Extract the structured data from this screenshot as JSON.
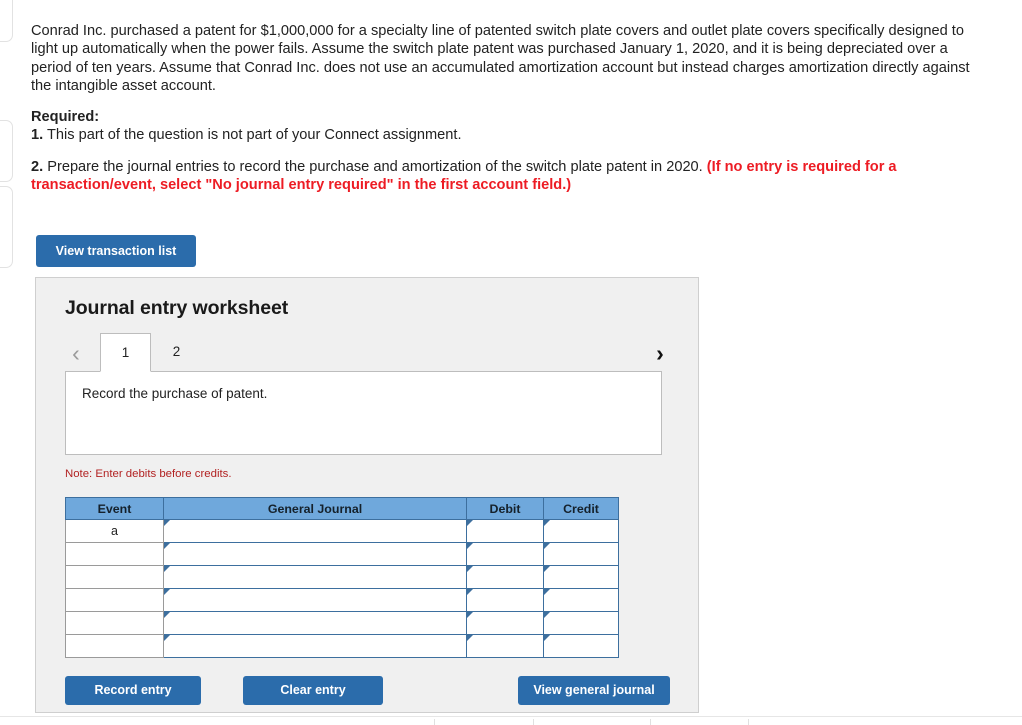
{
  "question": {
    "paragraph": "Conrad Inc. purchased a patent for $1,000,000 for a specialty line of patented switch plate covers and outlet plate covers specifically designed to light up automatically when the power fails. Assume the switch plate patent was purchased January 1, 2020, and it is being depreciated over a period of ten years. Assume that Conrad Inc. does not use an accumulated amortization account but instead charges amortization directly against the intangible asset account.",
    "required_label": "Required:",
    "req1_number": "1.",
    "req1_text": "This part of the question is not part of your Connect assignment.",
    "req2_number": "2.",
    "req2_text": "Prepare the journal entries to record the purchase and amortization of the switch plate patent in 2020.",
    "req2_red": "(If no entry is required for a transaction/event, select \"No journal entry required\" in the first account field.)"
  },
  "buttons": {
    "view_transaction_list": "View transaction list",
    "record_entry": "Record entry",
    "clear_entry": "Clear entry",
    "view_general_journal": "View general journal"
  },
  "worksheet": {
    "title": "Journal entry worksheet",
    "prev_arrow": "‹",
    "next_arrow": "›",
    "tabs": [
      {
        "label": "1",
        "active": true
      },
      {
        "label": "2",
        "active": false
      }
    ],
    "instruction": "Record the purchase of patent.",
    "note": "Note: Enter debits before credits.",
    "table": {
      "headers": [
        "Event",
        "General Journal",
        "Debit",
        "Credit"
      ],
      "rows": [
        {
          "event": "a",
          "general_journal": "",
          "debit": "",
          "credit": ""
        },
        {
          "event": "",
          "general_journal": "",
          "debit": "",
          "credit": ""
        },
        {
          "event": "",
          "general_journal": "",
          "debit": "",
          "credit": ""
        },
        {
          "event": "",
          "general_journal": "",
          "debit": "",
          "credit": ""
        },
        {
          "event": "",
          "general_journal": "",
          "debit": "",
          "credit": ""
        },
        {
          "event": "",
          "general_journal": "",
          "debit": "",
          "credit": ""
        }
      ]
    }
  },
  "colors": {
    "button_blue": "#2b6cab",
    "table_header_blue": "#6fa8dc",
    "cell_border_blue": "#3d6f9e",
    "alert_red": "#ed1c24",
    "note_red": "#b22222",
    "panel_gray": "#f0f0f0"
  }
}
